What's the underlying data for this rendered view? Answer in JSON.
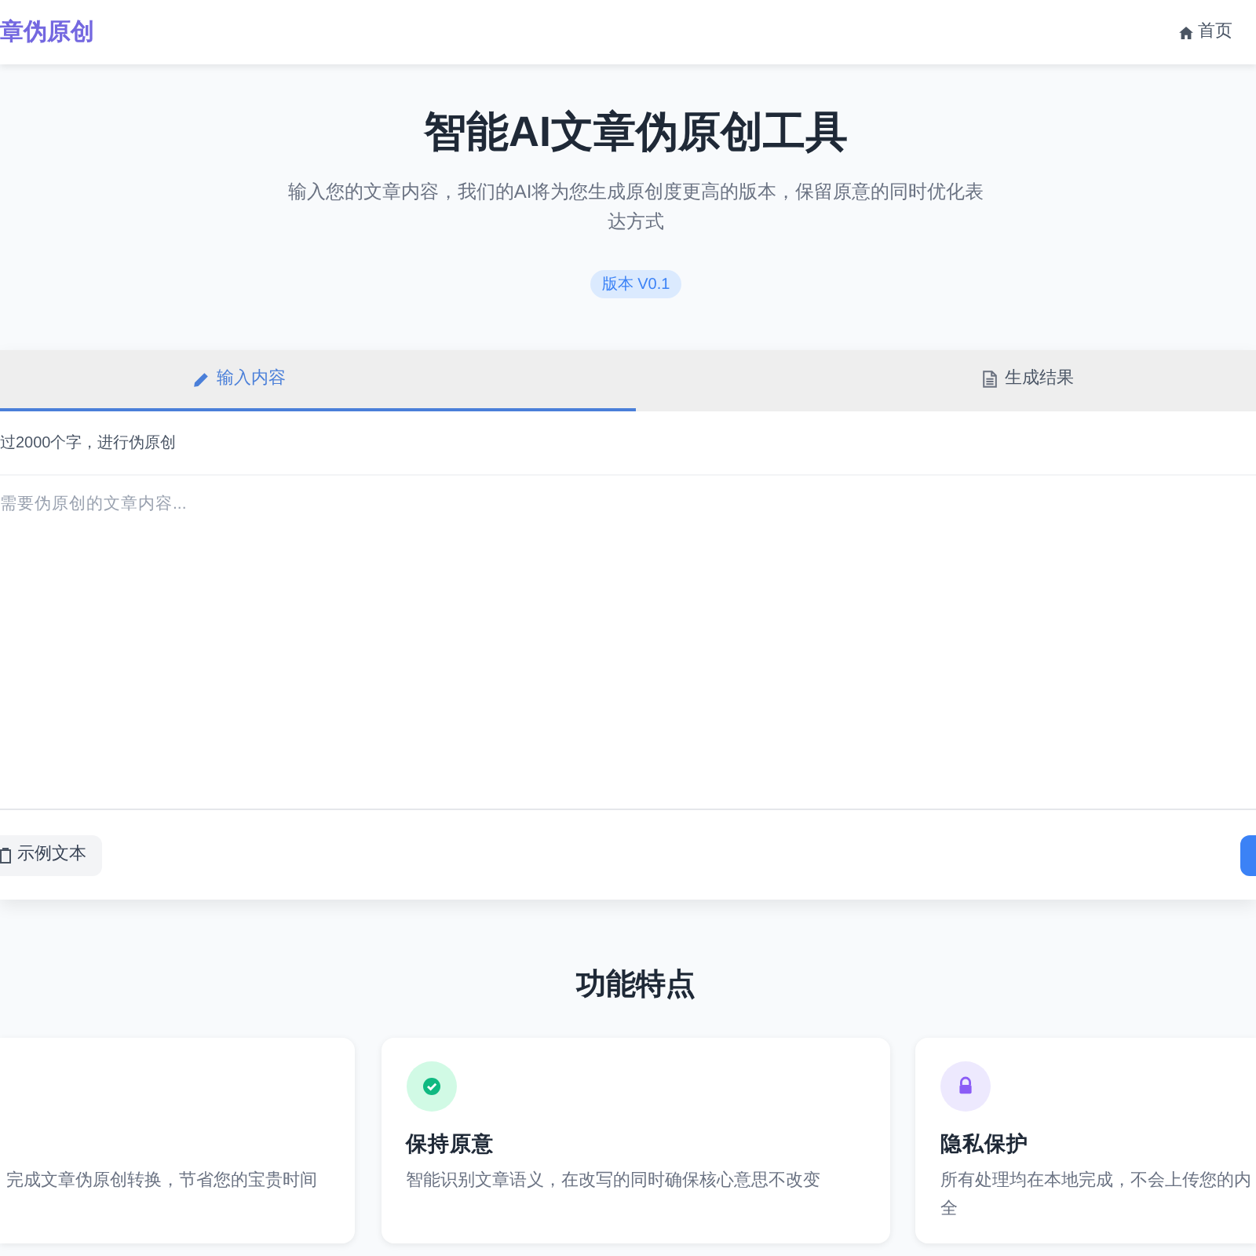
{
  "header": {
    "logo_text": "章伪原创",
    "nav": [
      {
        "label": "首页"
      }
    ]
  },
  "hero": {
    "title": "智能AI文章伪原创工具",
    "subtitle": "输入您的文章内容，我们的AI将为您生成原创度更高的版本，保留原意的同时优化表达方式",
    "badge": "版本 V0.1"
  },
  "editor": {
    "tabs": [
      {
        "kind": "input",
        "label": "输入内容",
        "selected": true
      },
      {
        "kind": "output",
        "label": "生成结果",
        "selected": false
      }
    ],
    "hint": "过2000个字，进行伪原创",
    "textarea": {
      "placeholder": "需要伪原创的文章内容..."
    },
    "sample_button": "示例文本"
  },
  "features": {
    "title": "功能特点",
    "cards": [
      {
        "description_lines": [
          "完成文章伪原创转换，节省您的宝贵时间"
        ]
      },
      {
        "kind": "check",
        "title": "保持原意",
        "description_lines": [
          "智能识别文章语义，在改写的同时确保核心意思不改变"
        ]
      },
      {
        "kind": "lock",
        "title": "隐私保护",
        "description_lines": [
          "所有处理均在本地完成，不会上传您的内",
          "全"
        ]
      }
    ]
  }
}
